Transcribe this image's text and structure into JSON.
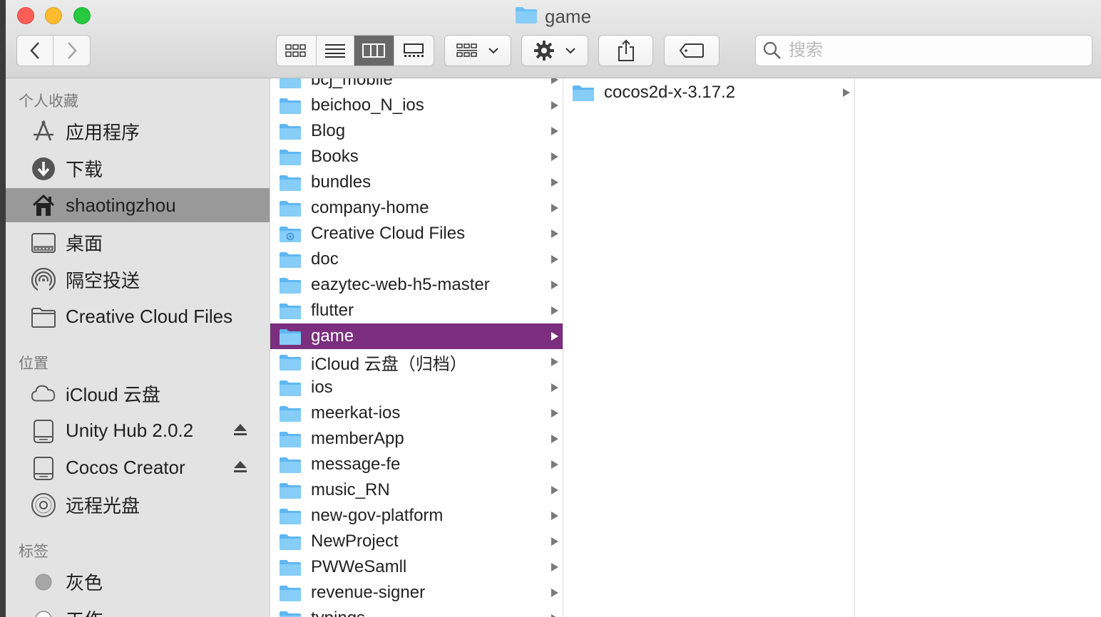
{
  "window": {
    "title": "game"
  },
  "toolbar": {
    "view_modes": [
      "icon-view-icon",
      "list-view-icon",
      "column-view-icon",
      "gallery-view-icon"
    ],
    "active_view": "column",
    "search_placeholder": "搜索"
  },
  "sidebar": {
    "favorites_header": "个人收藏",
    "favorites": [
      {
        "label": "应用程序",
        "icon": "applications-icon"
      },
      {
        "label": "下载",
        "icon": "downloads-icon"
      },
      {
        "label": "shaotingzhou",
        "icon": "home-icon",
        "selected": true
      },
      {
        "label": "桌面",
        "icon": "desktop-icon"
      },
      {
        "label": "隔空投送",
        "icon": "airdrop-icon"
      },
      {
        "label": "Creative Cloud Files",
        "icon": "folder-icon"
      }
    ],
    "locations_header": "位置",
    "locations": [
      {
        "label": "iCloud 云盘",
        "icon": "icloud-icon"
      },
      {
        "label": "Unity Hub 2.0.2",
        "icon": "disk-icon",
        "eject": true
      },
      {
        "label": "Cocos Creator",
        "icon": "disk-icon",
        "eject": true
      },
      {
        "label": "远程光盘",
        "icon": "optical-disc-icon"
      }
    ],
    "tags_header": "标签",
    "tags": [
      {
        "label": "灰色",
        "color": "#a7a7a7"
      },
      {
        "label": "工作",
        "color": "#ffffff"
      }
    ]
  },
  "columns": {
    "col1": [
      "bcj_mobile",
      "beichoo_N_ios",
      "Blog",
      "Books",
      "bundles",
      "company-home",
      "Creative Cloud Files",
      "doc",
      "eazytec-web-h5-master",
      "flutter",
      "game",
      "iCloud 云盘（归档）",
      "ios",
      "meerkat-ios",
      "memberApp",
      "message-fe",
      "music_RN",
      "new-gov-platform",
      "NewProject",
      "PWWeSamll",
      "revenue-signer",
      "typings"
    ],
    "col1_selected": "game",
    "col1_special": "Creative Cloud Files",
    "col2": [
      "cocos2d-x-3.17.2"
    ]
  },
  "colors": {
    "selection": "#7b2d7e",
    "sidebar_selection": "#999999",
    "folder": "#6bc0f5"
  }
}
